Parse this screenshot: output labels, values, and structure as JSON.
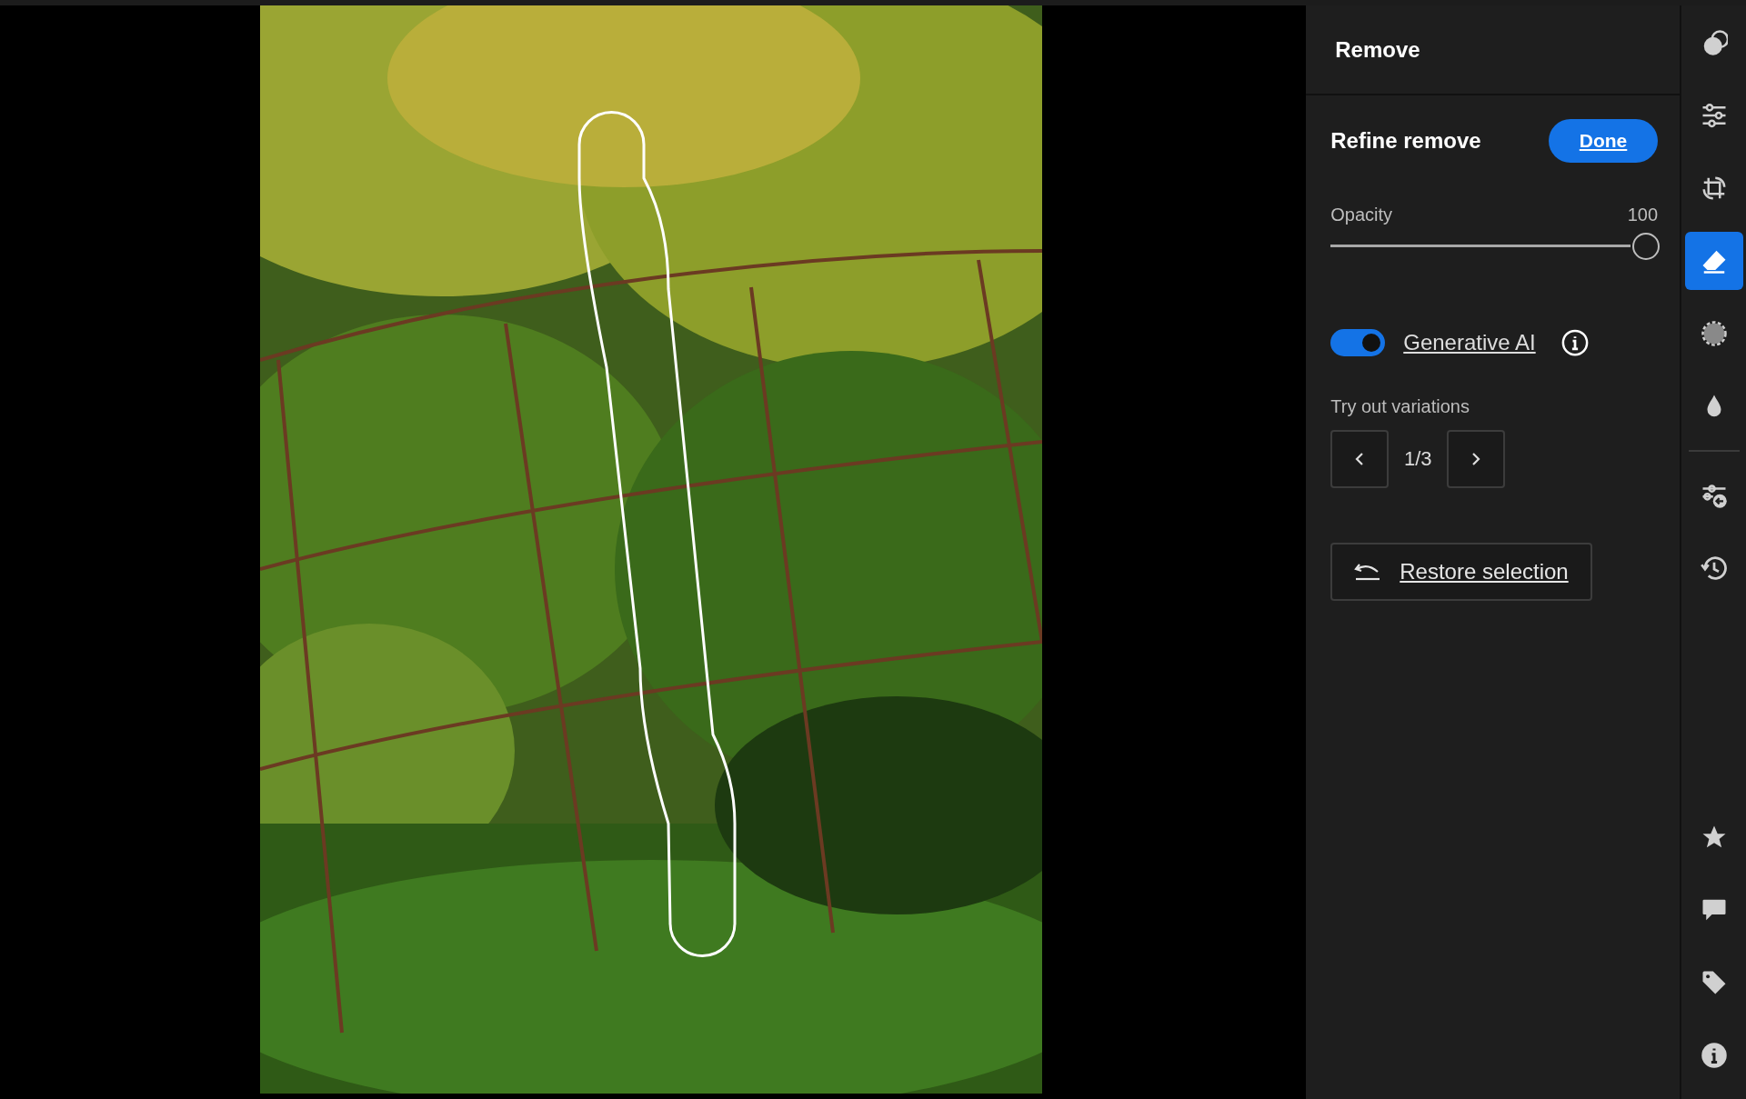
{
  "panel": {
    "title": "Remove",
    "section_title": "Refine remove",
    "done_button": "Done",
    "opacity": {
      "label": "Opacity",
      "reading": "100",
      "level": 1.0
    },
    "generative_ai": {
      "label": "Generative AI",
      "on": true
    },
    "variations": {
      "label": "Try out variations",
      "counter": "1/3"
    },
    "restore_button": "Restore selection"
  },
  "toolbar": [
    {
      "kind": "mask",
      "selected": false
    },
    {
      "kind": "sliders",
      "selected": false
    },
    {
      "kind": "crop",
      "selected": false
    },
    {
      "kind": "eraser",
      "selected": true
    },
    {
      "kind": "heal",
      "selected": false
    },
    {
      "kind": "drop",
      "selected": false
    },
    {
      "kind": "divider"
    },
    {
      "kind": "presets",
      "selected": false
    },
    {
      "kind": "history",
      "selected": false
    },
    {
      "kind": "spacer"
    },
    {
      "kind": "star",
      "selected": false
    },
    {
      "kind": "comment",
      "selected": false
    },
    {
      "kind": "tag",
      "selected": false
    },
    {
      "kind": "info",
      "selected": false
    }
  ]
}
